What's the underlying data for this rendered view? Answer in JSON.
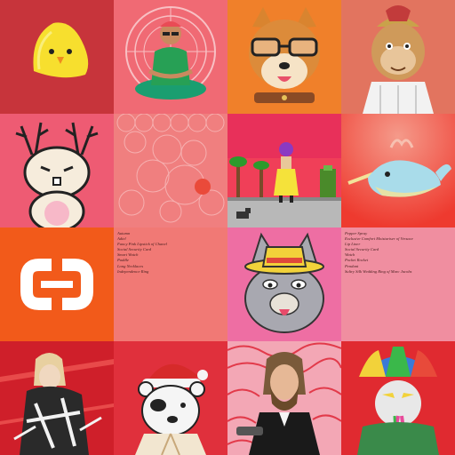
{
  "grid": {
    "tiles": [
      {
        "name": "chick",
        "bg": "#c7343b"
      },
      {
        "name": "meditating-man",
        "bg": "#f06a74"
      },
      {
        "name": "shiba-dog",
        "bg": "#f0802a"
      },
      {
        "name": "ape-helmet",
        "bg": "#e2745f"
      },
      {
        "name": "bunny",
        "bg": "#ee5b73"
      },
      {
        "name": "circles-art",
        "bg": "#f07f7f"
      },
      {
        "name": "pixel-street",
        "bg": "#f03f58"
      },
      {
        "name": "narwhal",
        "bg": "#ee3a2f"
      },
      {
        "name": "cc-logo",
        "bg": "#f25a1a"
      },
      {
        "name": "list-left",
        "bg": "#f17975"
      },
      {
        "name": "cat-hat",
        "bg": "#ee6ea3"
      },
      {
        "name": "list-right",
        "bg": "#f08ea0"
      },
      {
        "name": "glitch-figure",
        "bg": "#cf1f2a"
      },
      {
        "name": "polar-bear-santa",
        "bg": "#e0303c"
      },
      {
        "name": "bearded-man",
        "bg": "#f3a7b5"
      },
      {
        "name": "seal-umbrella",
        "bg": "#e02a30"
      }
    ]
  },
  "list_left": {
    "items": [
      "Autumn",
      "Adiel",
      "Fancy Pink Lipstick of Chanel",
      "Social Security Card",
      "Smart Watch",
      "Paddle",
      "Long Necklaces",
      "Independence Ring"
    ]
  },
  "list_right": {
    "items": [
      "Pepper Spray",
      "Exclusive Comfort Moisturiser of Versace",
      "Lip Liner",
      "Social Security Card",
      "Watch",
      "Pocket Rocket",
      "Pendant",
      "Sultry Silk Wedding Ring of Marc Jacobs"
    ]
  }
}
